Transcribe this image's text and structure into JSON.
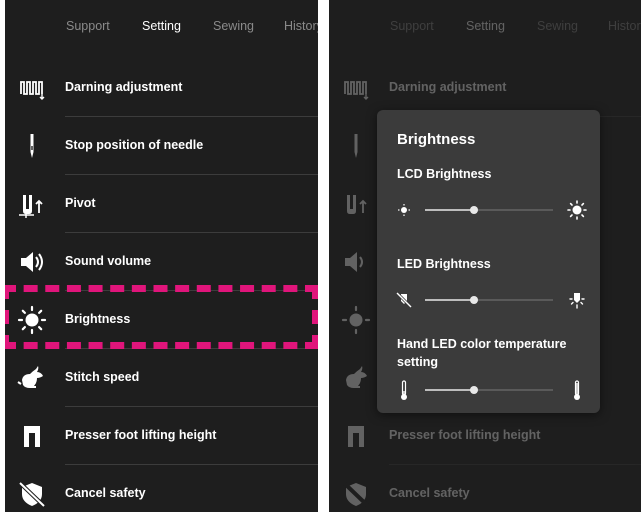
{
  "tabs": [
    "Support",
    "Setting",
    "Sewing",
    "History"
  ],
  "active_tab": "Setting",
  "settings_items": [
    {
      "label": "Darning adjustment",
      "icon": "darning-icon"
    },
    {
      "label": "Stop position of needle",
      "icon": "needle-icon"
    },
    {
      "label": "Pivot",
      "icon": "pivot-icon"
    },
    {
      "label": "Sound volume",
      "icon": "speaker-icon"
    },
    {
      "label": "Brightness",
      "icon": "sun-icon"
    },
    {
      "label": "Stitch speed",
      "icon": "rabbit-icon"
    },
    {
      "label": "Presser foot lifting height",
      "icon": "presser-foot-icon"
    },
    {
      "label": "Cancel safety",
      "icon": "safety-off-icon"
    }
  ],
  "highlight": {
    "item": "Brightness",
    "color": "#e0157b"
  },
  "brightness_popup": {
    "title": "Brightness",
    "lcd": {
      "label": "LCD Brightness",
      "value_fraction": 0.38,
      "min_icon": "sun-small-icon",
      "max_icon": "sun-large-icon"
    },
    "led": {
      "label": "LED Brightness",
      "value_fraction": 0.38,
      "min_icon": "led-off-icon",
      "max_icon": "led-bright-icon"
    },
    "hand_led": {
      "label": "Hand LED color temperature setting",
      "value_fraction": 0.38,
      "min_icon": "thermometer-low-icon",
      "max_icon": "thermometer-high-icon"
    }
  },
  "colors": {
    "background": "#1e1e1e",
    "popup": "#3b3b3b",
    "text": "#ffffff",
    "tab_inactive": "#8a8a8a"
  }
}
